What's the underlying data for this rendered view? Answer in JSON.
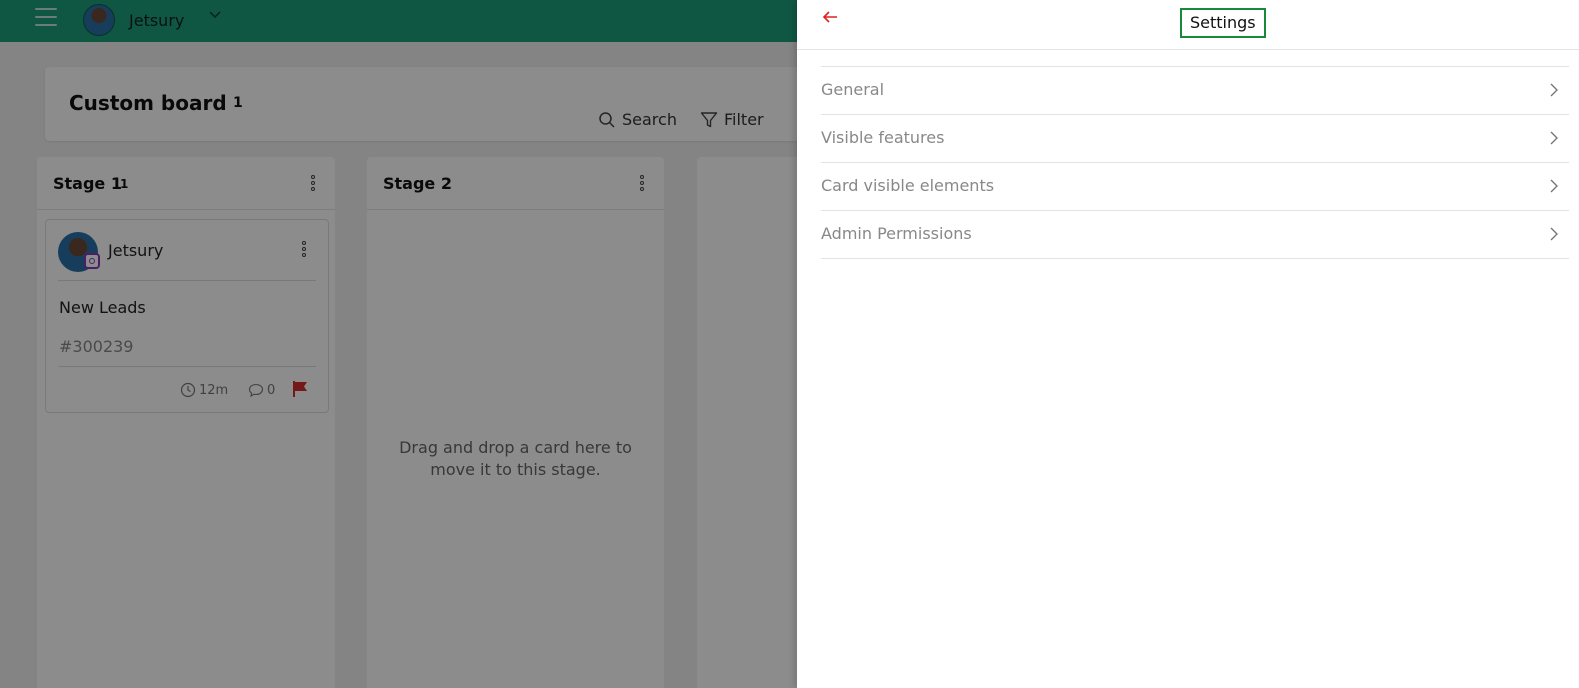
{
  "topbar": {
    "user_name": "Jetsury"
  },
  "board": {
    "title": "Custom board",
    "count": "1",
    "search_label": "Search",
    "filter_label": "Filter"
  },
  "stages": [
    {
      "title": "Stage 1",
      "count": "1",
      "card": {
        "name": "Jetsury",
        "text": "New Leads",
        "id": "#300239",
        "time": "12m",
        "comments": "0"
      }
    },
    {
      "title": "Stage 2",
      "drop_hint": "Drag and drop a card here to move it to this stage."
    }
  ],
  "settings": {
    "title": "Settings",
    "items": [
      {
        "label": "General"
      },
      {
        "label": "Visible features"
      },
      {
        "label": "Card visible elements"
      },
      {
        "label": "Admin Permissions"
      }
    ]
  },
  "colors": {
    "topbar": "#1e9e7a",
    "accent_back": "#e02020",
    "title_outline": "#1a8a3a",
    "flag": "#d32f2f"
  }
}
